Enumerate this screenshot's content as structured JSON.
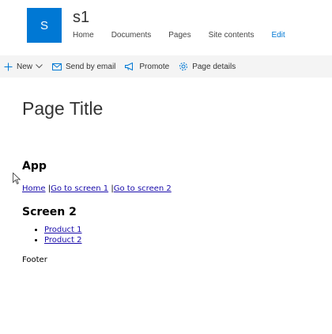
{
  "site": {
    "logo_letter": "S",
    "name": "s1",
    "nav": [
      "Home",
      "Documents",
      "Pages",
      "Site contents"
    ],
    "edit_label": "Edit"
  },
  "commands": {
    "new_label": "New",
    "send_by_email_label": "Send by email",
    "promote_label": "Promote",
    "page_details_label": "Page details"
  },
  "page": {
    "title": "Page Title"
  },
  "app": {
    "heading": "App",
    "links": [
      "Home",
      "Go to screen 1",
      "Go to screen 2"
    ],
    "separator": " |",
    "screen_heading": "Screen 2",
    "products": [
      "Product 1",
      "Product 2"
    ],
    "footer": "Footer"
  },
  "colors": {
    "accent": "#0078d4",
    "command_bar_bg": "#f4f4f4",
    "link": "#1a0dab"
  },
  "icons": {
    "new": "plus-icon",
    "email": "mail-icon",
    "promote": "megaphone-icon",
    "page_details": "gear-icon",
    "cursor": "mouse-pointer-icon"
  }
}
